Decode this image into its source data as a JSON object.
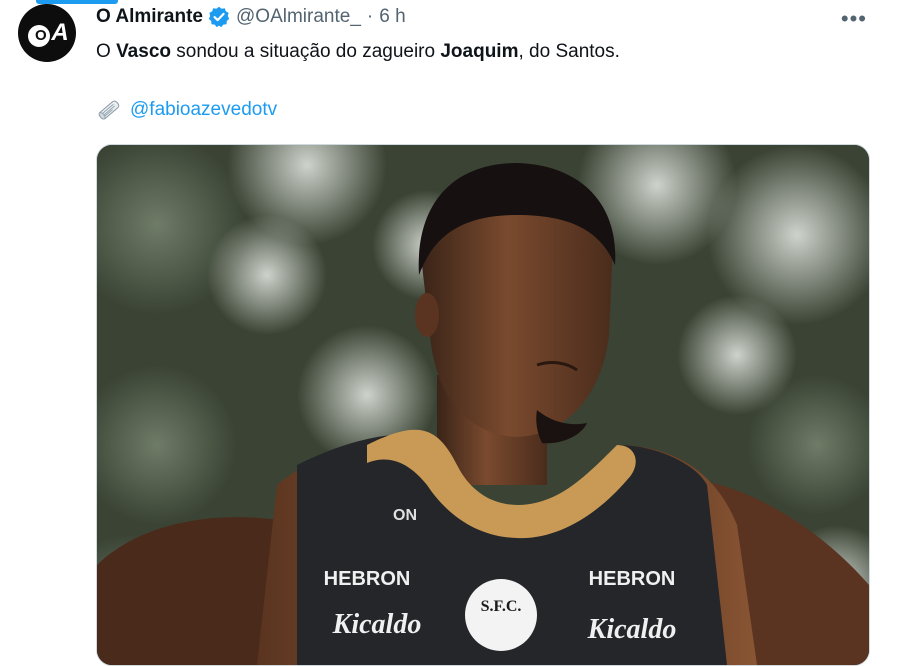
{
  "tweet": {
    "author_name": "O Almirante",
    "handle": "@OAlmirante_",
    "separator": "·",
    "time": "6 h",
    "more_label": "•••",
    "text": {
      "part1": "O ",
      "bold1": "Vasco",
      "part2": " sondou a situação do zagueiro ",
      "bold2": "Joaquim",
      "part3": ", do Santos."
    },
    "mention": "@fabioazevedotv",
    "avatar_text": "A",
    "avatar_o": "O"
  },
  "image": {
    "shirt_left_brand": "HEBRON",
    "shirt_right_brand": "HEBRON",
    "shirt_left_sponsor": "Kicaldo",
    "shirt_right_sponsor": "Kicaldo",
    "crest_text": "S.F.C.",
    "collar_text": "ON"
  },
  "colors": {
    "accent": "#1d9bf0",
    "verified": "#1d9bf0",
    "muted": "#536471"
  },
  "icons": {
    "verified": "verified-badge-icon",
    "more": "more-options-icon",
    "news": "newspaper-icon"
  }
}
